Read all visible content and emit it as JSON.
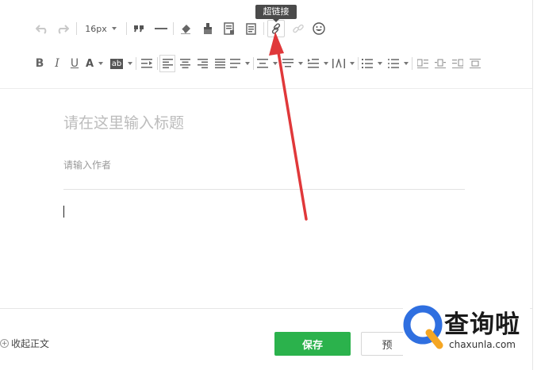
{
  "toolbar": {
    "font_size": "16px",
    "tooltip": "超链接",
    "row1_icons": [
      "undo-icon",
      "redo-icon",
      "font-size-select",
      "blockquote-icon",
      "horizontal-rule-icon",
      "eraser-icon",
      "format-brush-icon",
      "insert-template-icon",
      "document-icon",
      "link-icon",
      "unlink-icon",
      "emoji-icon"
    ],
    "row2_icons": [
      "bold-icon",
      "italic-icon",
      "underline-icon",
      "font-color-icon",
      "background-color-icon",
      "indent-icon",
      "align-left-icon",
      "align-center-icon",
      "align-right-icon",
      "justify-icon",
      "align-dropdown-icon",
      "line-height-icon",
      "paragraph-spacing-icon",
      "first-line-indent-icon",
      "letter-spacing-icon",
      "ordered-list-icon",
      "unordered-list-icon",
      "float-left-icon",
      "float-center-icon",
      "float-right-icon",
      "float-none-icon"
    ],
    "bold_glyph": "B",
    "italic_glyph": "I",
    "underline_glyph": "U",
    "font_color_glyph": "A",
    "bg_color_glyph": "ab"
  },
  "editor": {
    "title_placeholder": "请在这里输入标题",
    "author_placeholder": "请输入作者"
  },
  "footer": {
    "collapse_label": "收起正文",
    "save_label": "保存",
    "preview_label": "预"
  },
  "watermark": {
    "brand": "查询啦",
    "url": "chaxunla.com"
  },
  "colors": {
    "accent": "#2bb24c",
    "arrow": "#e0383a",
    "watermark_blue": "#2f6fe0",
    "watermark_orange": "#f5a623"
  }
}
